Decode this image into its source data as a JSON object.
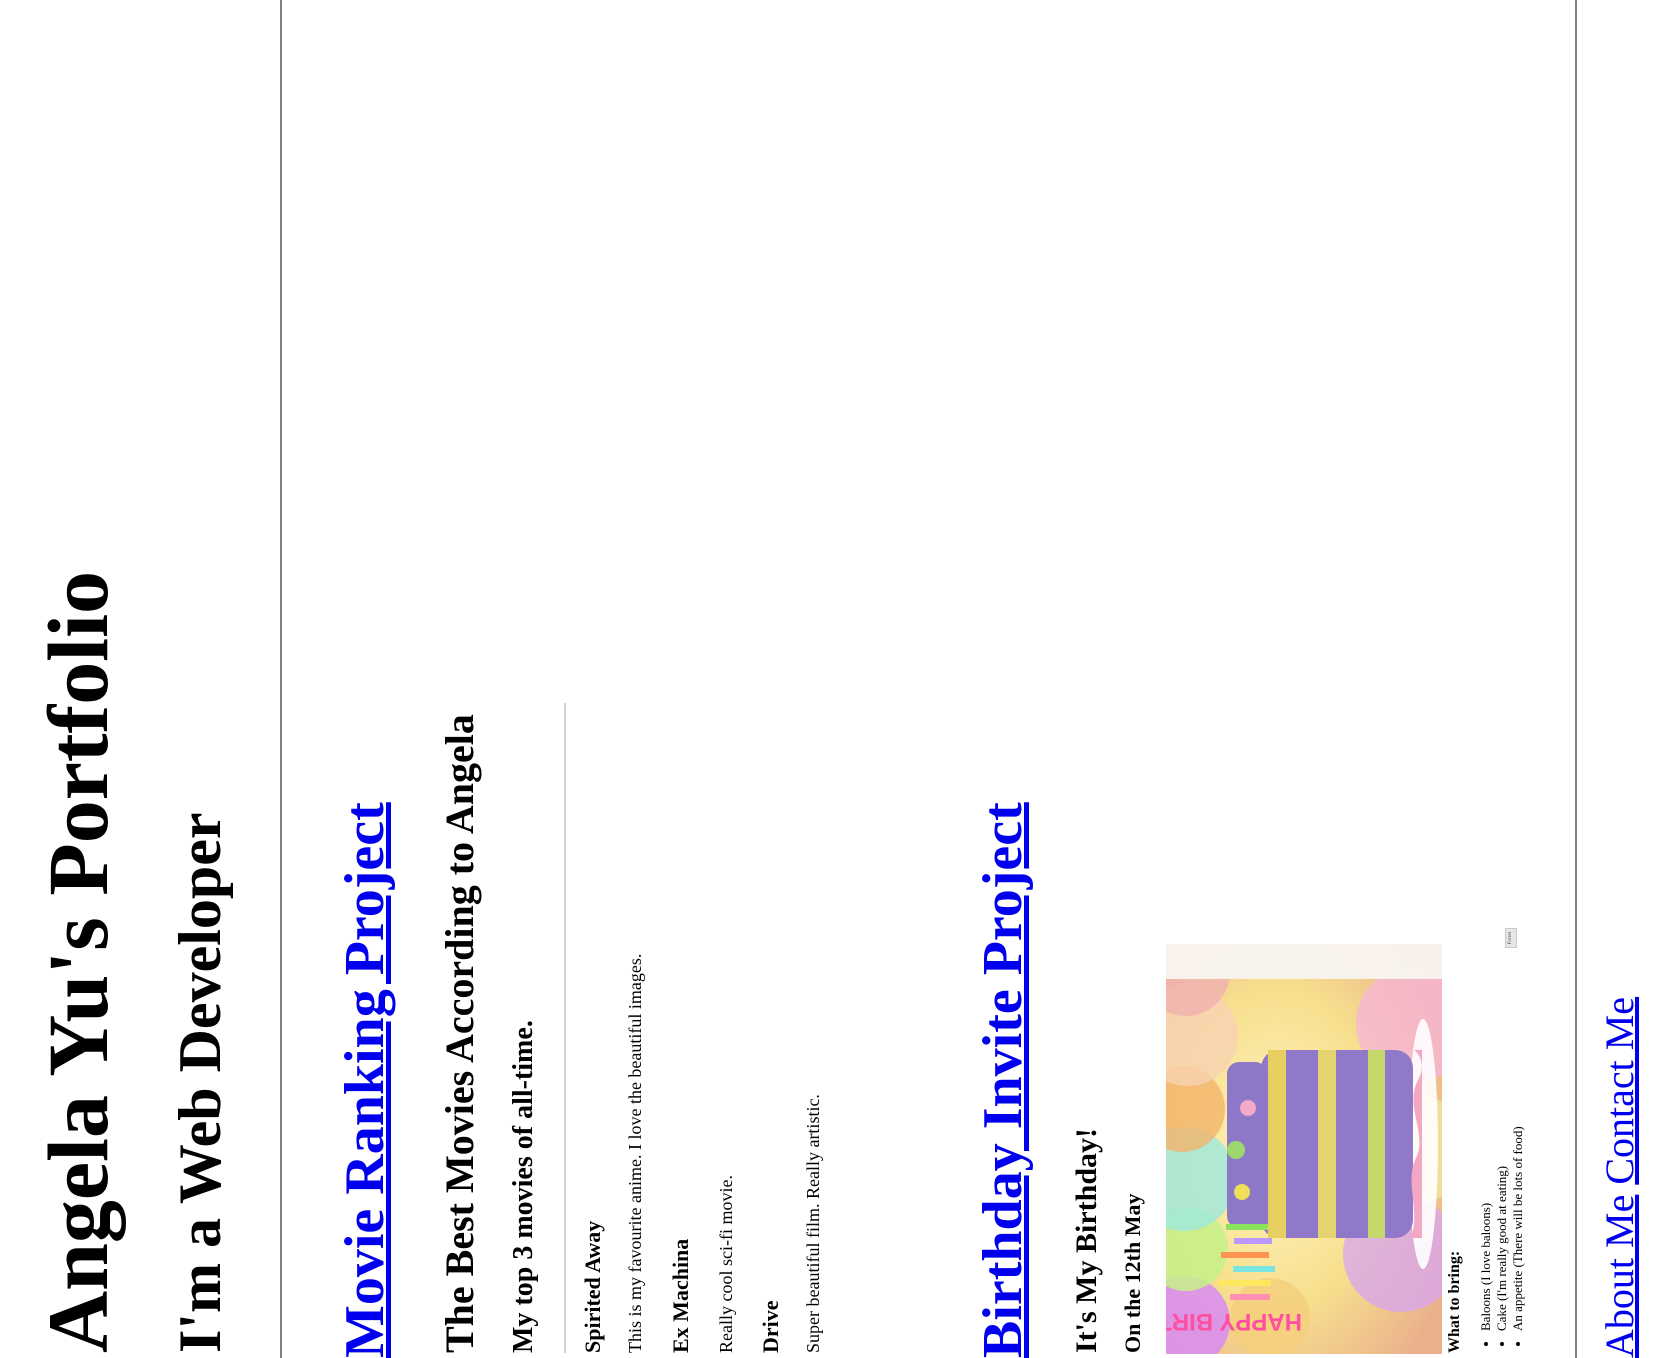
{
  "header": {
    "title": "Angela Yu's Portfolio",
    "subtitle": "I'm a Web Developer"
  },
  "projects": {
    "movie": {
      "link_text": "Movie Ranking Project",
      "heading": "The Best Movies According to Angela",
      "subheading": "My top 3 movies of all-time.",
      "items": [
        {
          "title": "Spirited Away",
          "description": "This is my favourite anime. I love the beautiful images."
        },
        {
          "title": "Ex Machina",
          "description": "Really cool sci-fi movie."
        },
        {
          "title": "Drive",
          "description": "Super beautiful film. Really artistic."
        }
      ]
    },
    "birthday": {
      "link_text": "Birthday Invite Project",
      "heading": "It's My Birthday!",
      "date": "On the 12th May",
      "cake_text": "HAPPY BIRTHDAY",
      "small_label": "Forest",
      "bring_heading": "What to bring:",
      "bring_items": [
        "Baloons (I love baloons)",
        "Cake (I'm really good at eating)",
        "An appetite (There will be lots of food)"
      ]
    }
  },
  "footer": {
    "about_label": "About Me",
    "contact_label": "Contact Me"
  }
}
